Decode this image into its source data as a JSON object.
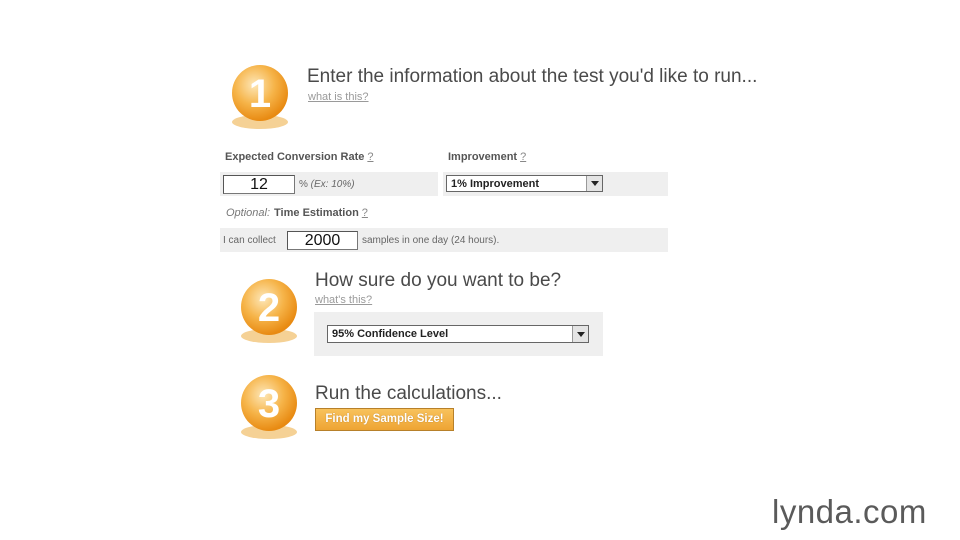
{
  "step1": {
    "number": "1",
    "title": "Enter the information about the test you'd like to run...",
    "help_link": "what is this?"
  },
  "conversion": {
    "label": "Expected Conversion Rate",
    "help": "?",
    "value": "12",
    "hint_prefix": "% ",
    "hint_example": "(Ex: 10%)"
  },
  "improvement": {
    "label": "Improvement",
    "help": "?",
    "selected": "1% Improvement"
  },
  "time_estimation": {
    "optional_prefix": "Optional:",
    "label": "Time Estimation",
    "help": "?",
    "prefix_text": "I can collect",
    "value": "2000",
    "suffix_text": "samples in one day (24 hours)."
  },
  "step2": {
    "number": "2",
    "title": "How sure do you want to be?",
    "help_link": "what's this?",
    "confidence_selected": "95% Confidence Level"
  },
  "step3": {
    "number": "3",
    "title": "Run the calculations...",
    "button_label": "Find my Sample Size!"
  },
  "watermark": {
    "brand": "lynda.com"
  },
  "colors": {
    "badge_orange": "#f4a52c",
    "button_orange": "#f0aa3a",
    "panel_gray": "#efefef"
  }
}
